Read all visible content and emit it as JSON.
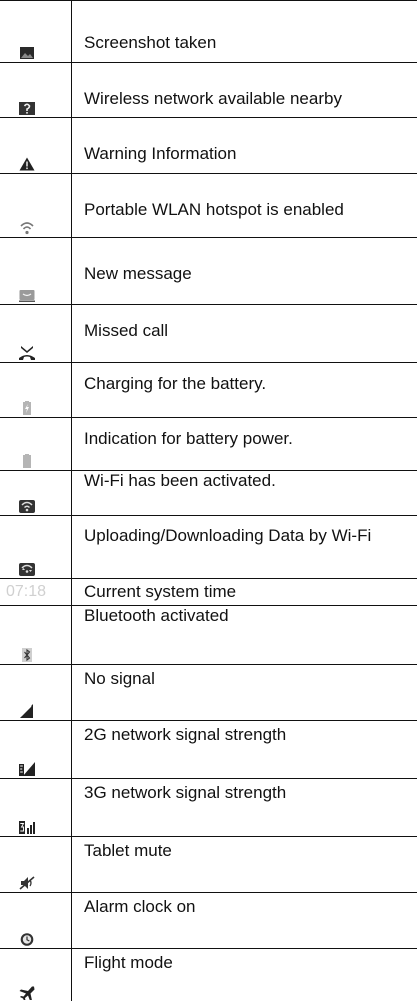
{
  "table": {
    "rows": [
      {
        "icon": "screenshot-icon",
        "label": "Screenshot taken"
      },
      {
        "icon": "wifi-unknown-icon",
        "label": "Wireless network available nearby"
      },
      {
        "icon": "warning-icon",
        "label": "Warning Information"
      },
      {
        "icon": "hotspot-icon",
        "label": "Portable WLAN hotspot is enabled"
      },
      {
        "icon": "message-icon",
        "label": "New message"
      },
      {
        "icon": "missed-call-icon",
        "label": "Missed call"
      },
      {
        "icon": "battery-charging-icon",
        "label": "Charging for the battery."
      },
      {
        "icon": "battery-icon",
        "label": "Indication for battery power."
      },
      {
        "icon": "wifi-icon",
        "label": "Wi-Fi has been activated."
      },
      {
        "icon": "wifi-data-icon",
        "label": "Uploading/Downloading Data by Wi-Fi"
      },
      {
        "icon": "clock-text",
        "time": "07:18",
        "label": "Current system time"
      },
      {
        "icon": "bluetooth-icon",
        "label": "Bluetooth activated"
      },
      {
        "icon": "no-signal-icon",
        "label": "No signal"
      },
      {
        "icon": "signal-2g-icon",
        "label": "2G network signal strength"
      },
      {
        "icon": "signal-3g-icon",
        "label": "3G network signal strength"
      },
      {
        "icon": "mute-icon",
        "label": "Tablet mute"
      },
      {
        "icon": "alarm-icon",
        "label": "Alarm clock on"
      },
      {
        "icon": "flight-mode-icon",
        "label": "Flight mode"
      }
    ]
  }
}
